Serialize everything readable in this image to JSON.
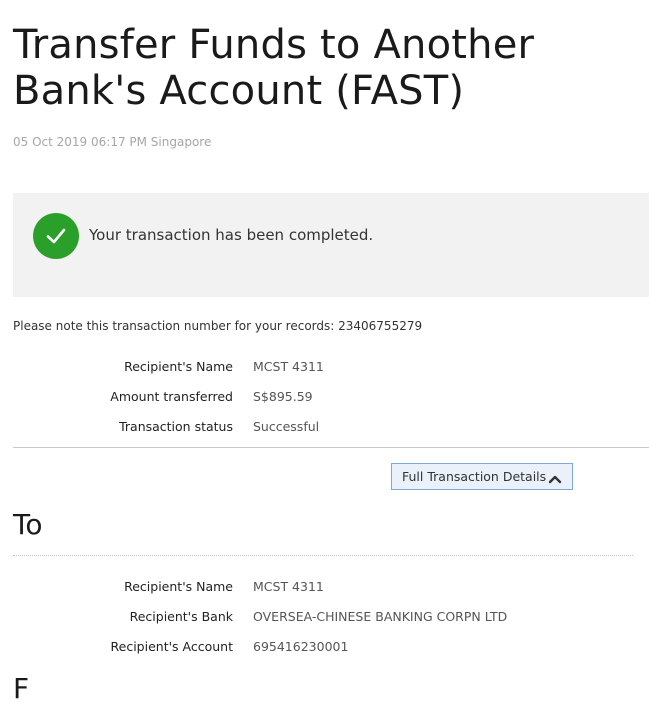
{
  "page": {
    "title": "Transfer Funds to Another Bank's Account (FAST)",
    "timestamp": "05 Oct 2019 06:17 PM Singapore"
  },
  "status": {
    "message": "Your transaction has been completed.",
    "icon": "check-icon",
    "color": "#2aa02a"
  },
  "note": "Please note this transaction number for your records: 23406755279",
  "summary": [
    {
      "label": "Recipient's Name",
      "value": "MCST 4311"
    },
    {
      "label": "Amount transferred",
      "value": "S$895.59"
    },
    {
      "label": "Transaction status",
      "value": "Successful"
    }
  ],
  "details_toggle": {
    "label": "Full Transaction Details",
    "icon": "chevron-up-icon",
    "accent": "#7fa8d9"
  },
  "to_section": {
    "heading": "To",
    "fields": [
      {
        "label": "Recipient's Name",
        "value": "MCST 4311"
      },
      {
        "label": "Recipient's Bank",
        "value": "OVERSEA-CHINESE BANKING CORPN LTD"
      },
      {
        "label": "Recipient's Account",
        "value": "695416230001"
      }
    ]
  },
  "next_section": {
    "heading": "F"
  }
}
